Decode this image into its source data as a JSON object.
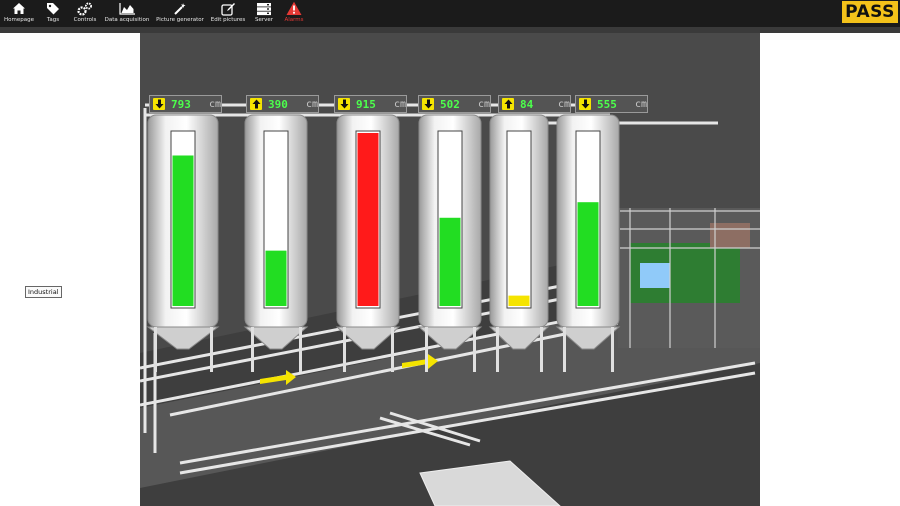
{
  "toolbar": {
    "items": [
      {
        "label": "Homepage",
        "icon": "home-icon"
      },
      {
        "label": "Tags",
        "icon": "tags-icon"
      },
      {
        "label": "Controls",
        "icon": "gears-icon"
      },
      {
        "label": "Data acquisition",
        "icon": "area-chart-icon"
      },
      {
        "label": "Picture generator",
        "icon": "magic-wand-icon"
      },
      {
        "label": "Edit pictures",
        "icon": "edit-icon"
      },
      {
        "label": "Server",
        "icon": "server-icon"
      },
      {
        "label": "Alarms",
        "icon": "warning-icon"
      }
    ],
    "logo_text": "PASS"
  },
  "sidebar": {
    "industrial_label": "Industrial"
  },
  "tanks": [
    {
      "value": "793",
      "unit": "cm",
      "direction": "down",
      "fill_fraction": 0.87,
      "color": "#22dd22"
    },
    {
      "value": "390",
      "unit": "cm",
      "direction": "up",
      "fill_fraction": 0.32,
      "color": "#22dd22"
    },
    {
      "value": "915",
      "unit": "cm",
      "direction": "down",
      "fill_fraction": 1.0,
      "color": "#ff1a1a"
    },
    {
      "value": "502",
      "unit": "cm",
      "direction": "down",
      "fill_fraction": 0.51,
      "color": "#22dd22"
    },
    {
      "value": "84",
      "unit": "cm",
      "direction": "up",
      "fill_fraction": 0.06,
      "color": "#f5e400"
    },
    {
      "value": "555",
      "unit": "cm",
      "direction": "down",
      "fill_fraction": 0.6,
      "color": "#22dd22"
    }
  ],
  "colors": {
    "toolbar_bg": "#1b1b1b",
    "alarm": "#e53935",
    "logo_bg": "#f4c21a",
    "value_text": "#4cff4c",
    "flow_arrow": "#f5e400"
  }
}
